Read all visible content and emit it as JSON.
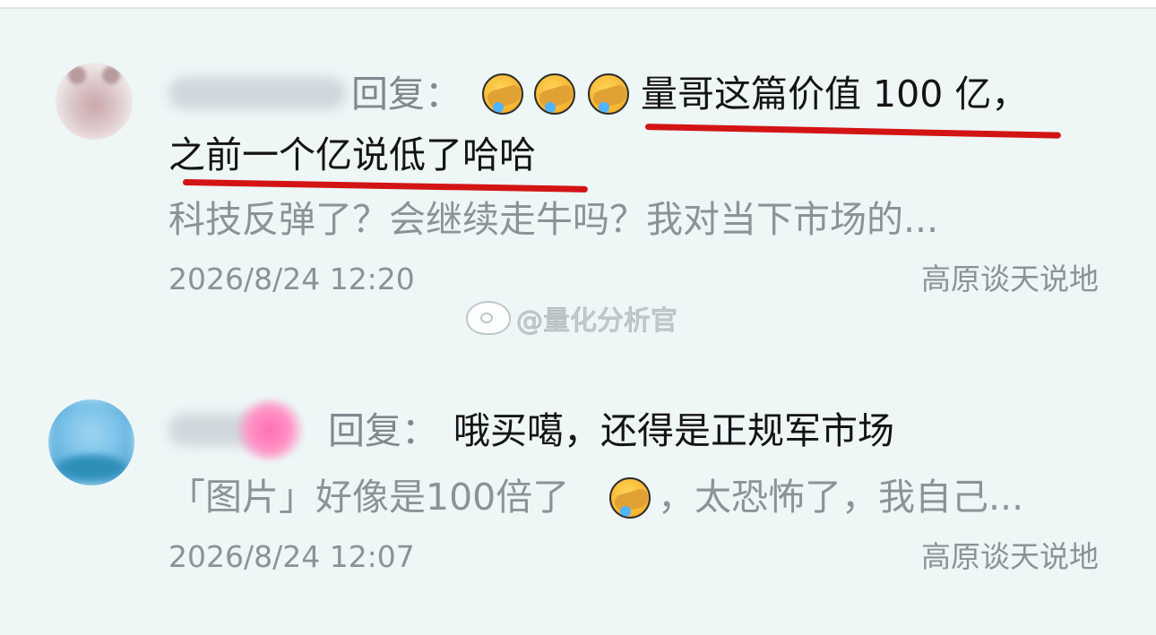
{
  "comments": [
    {
      "reply_label": "回复：",
      "emoji": "face-with-hand-over-eyes-crying-laughing",
      "emoji_count": 3,
      "content_line1": "量哥这篇价值 100 亿，",
      "content_line2": "之前一个亿说低了哈哈",
      "highlight_color": "#d31414",
      "preview": "科技反弹了？会继续走牛吗？我对当下市场的...",
      "time": "2026/8/24 12:20",
      "source": "高原谈天说地"
    },
    {
      "reply_label": "回复：",
      "content": "哦买噶，还得是正规军市场",
      "preview_before_emoji": "「图片」好像是100倍了",
      "preview_after_emoji": "，太恐怖了，我自己...",
      "emoji": "face-with-hand-over-eyes-crying-laughing",
      "time": "2026/8/24 12:07",
      "source": "高原谈天说地"
    }
  ],
  "watermark": {
    "text": "@量化分析官",
    "icon": "weibo-logo"
  },
  "colors": {
    "background": "#eef6f6",
    "primary_text": "#141414",
    "secondary_text": "#8c9396"
  }
}
